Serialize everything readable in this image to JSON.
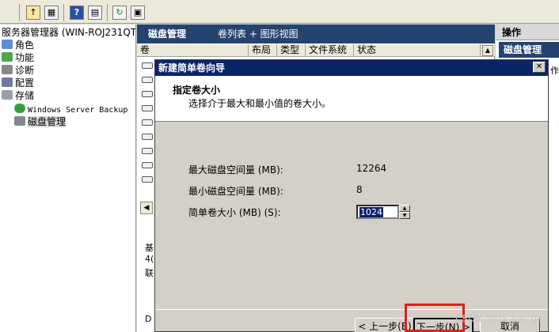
{
  "toolbar": {
    "buttons": [
      "up-folder-icon",
      "properties-icon",
      "help-icon",
      "view-icon",
      "refresh-icon",
      "export-icon"
    ]
  },
  "tree": {
    "root": "服务器管理器 (WIN-ROJ231QTFT",
    "roles": "角色",
    "features": "功能",
    "diagnostics": "诊断",
    "config": "配置",
    "storage": "存储",
    "backup": "Windows Server Backup",
    "disk_mgmt": "磁盘管理"
  },
  "middle": {
    "title": "磁盘管理",
    "view_label": "卷列表 + 图形视图",
    "columns": [
      "卷",
      "布局",
      "类型",
      "文件系统",
      "状态"
    ],
    "stubs": [
      "基",
      "4(",
      "联",
      "D"
    ]
  },
  "actions": {
    "header": "操作",
    "selected": "磁盘管理",
    "side_char": "作"
  },
  "wizard": {
    "title": "新建简单卷向导",
    "close": "✕",
    "heading": "指定卷大小",
    "subheading": "选择介于最大和最小值的卷大小。",
    "max_label": "最大磁盘空间量 (MB):",
    "max_value": "12264",
    "min_label": "最小磁盘空间量 (MB):",
    "min_value": "8",
    "size_label": "简单卷大小 (MB) (S):",
    "size_value": "1024",
    "back_btn": "< 上一步(B)",
    "next_btn": "下一步(N) >",
    "cancel_btn": "取消"
  },
  "watermark": "CSDN @da_pai_ge",
  "colors": {
    "header_blue": "#25436f",
    "title_blue": "#0a246a",
    "highlight_red": "#e0201a"
  }
}
